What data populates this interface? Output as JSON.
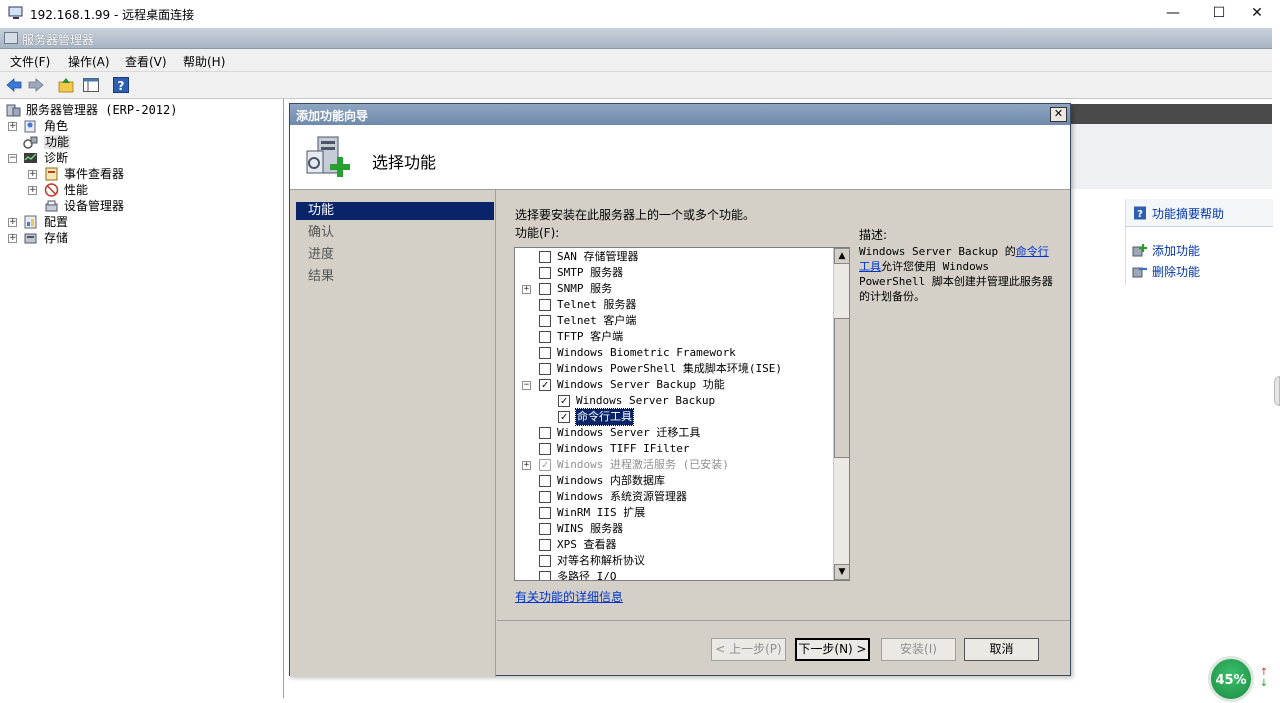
{
  "rdp": {
    "title": "192.168.1.99 - 远程桌面连接",
    "minimize": "—",
    "maximize": "☐",
    "close": "✕"
  },
  "app": {
    "title": "服务器管理器"
  },
  "menu": {
    "file": "文件(F)",
    "action": "操作(A)",
    "view": "查看(V)",
    "help": "帮助(H)"
  },
  "tree": {
    "root": "服务器管理器 (ERP-2012)",
    "roles": "角色",
    "features": "功能",
    "diagnostics": "诊断",
    "event_viewer": "事件查看器",
    "performance": "性能",
    "device_manager": "设备管理器",
    "configuration": "配置",
    "storage": "存储"
  },
  "actions": {
    "features_help": "功能摘要帮助",
    "add_features": "添加功能",
    "remove_features": "删除功能"
  },
  "dialog": {
    "title": "添加功能向导",
    "close": "✕",
    "heading": "选择功能",
    "steps": [
      "功能",
      "确认",
      "进度",
      "结果"
    ],
    "intro": "选择要安装在此服务器上的一个或多个功能。",
    "features_label": "功能(F):",
    "description_label": "描述:",
    "description": {
      "part1": "Windows Server Backup 的",
      "link": "命令行工具",
      "part2": "允许您使用 Windows PowerShell 脚本创建并管理此服务器的计划备份。"
    },
    "more_info_link": "有关功能的详细信息",
    "buttons": {
      "back": "< 上一步(P)",
      "next": "下一步(N) >",
      "install": "安装(I)",
      "cancel": "取消"
    },
    "features": [
      {
        "label": "SAN 存储管理器",
        "checked": false,
        "expand": "",
        "indent": 0,
        "disabled": false
      },
      {
        "label": "SMTP 服务器",
        "checked": false,
        "expand": "",
        "indent": 0,
        "disabled": false
      },
      {
        "label": "SNMP 服务",
        "checked": false,
        "expand": "+",
        "indent": 0,
        "disabled": false
      },
      {
        "label": "Telnet 服务器",
        "checked": false,
        "expand": "",
        "indent": 0,
        "disabled": false
      },
      {
        "label": "Telnet 客户端",
        "checked": false,
        "expand": "",
        "indent": 0,
        "disabled": false
      },
      {
        "label": "TFTP 客户端",
        "checked": false,
        "expand": "",
        "indent": 0,
        "disabled": false
      },
      {
        "label": "Windows Biometric Framework",
        "checked": false,
        "expand": "",
        "indent": 0,
        "disabled": false
      },
      {
        "label": "Windows PowerShell 集成脚本环境(ISE)",
        "checked": false,
        "expand": "",
        "indent": 0,
        "disabled": false
      },
      {
        "label": "Windows Server Backup 功能",
        "checked": true,
        "expand": "−",
        "indent": 0,
        "disabled": false
      },
      {
        "label": "Windows Server Backup",
        "checked": true,
        "expand": "",
        "indent": 1,
        "disabled": false
      },
      {
        "label": "命令行工具",
        "checked": true,
        "expand": "",
        "indent": 1,
        "disabled": false,
        "selected": true
      },
      {
        "label": "Windows Server 迁移工具",
        "checked": false,
        "expand": "",
        "indent": 0,
        "disabled": false
      },
      {
        "label": "Windows TIFF IFilter",
        "checked": false,
        "expand": "",
        "indent": 0,
        "disabled": false
      },
      {
        "label": "Windows 进程激活服务  (已安装)",
        "checked": true,
        "expand": "+",
        "indent": 0,
        "disabled": true
      },
      {
        "label": "Windows 内部数据库",
        "checked": false,
        "expand": "",
        "indent": 0,
        "disabled": false
      },
      {
        "label": "Windows 系统资源管理器",
        "checked": false,
        "expand": "",
        "indent": 0,
        "disabled": false
      },
      {
        "label": "WinRM IIS 扩展",
        "checked": false,
        "expand": "",
        "indent": 0,
        "disabled": false
      },
      {
        "label": "WINS 服务器",
        "checked": false,
        "expand": "",
        "indent": 0,
        "disabled": false
      },
      {
        "label": "XPS 查看器",
        "checked": false,
        "expand": "",
        "indent": 0,
        "disabled": false
      },
      {
        "label": "对等名称解析协议",
        "checked": false,
        "expand": "",
        "indent": 0,
        "disabled": false
      },
      {
        "label": "多路径 I/O",
        "checked": false,
        "expand": "",
        "indent": 0,
        "disabled": false
      }
    ]
  },
  "network_badge": {
    "value": "45%",
    "up": "↑",
    "down": "↓"
  },
  "colors": {
    "selection": "#0a246a",
    "link": "#0033cc",
    "dialog_bg": "#d4d0c8"
  }
}
